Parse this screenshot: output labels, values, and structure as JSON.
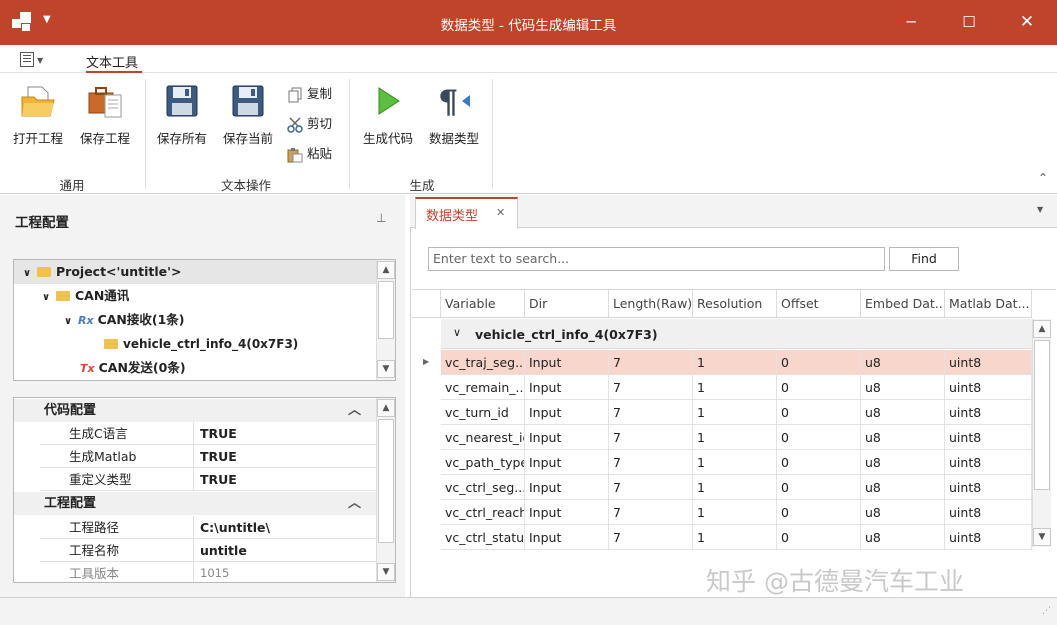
{
  "window": {
    "title": "数据类型 - 代码生成编辑工具"
  },
  "ribbon": {
    "tab_label": "文本工具",
    "buttons": {
      "open_project": "打开工程",
      "save_project": "保存工程",
      "save_all": "保存所有",
      "save_current": "保存当前",
      "copy": "复制",
      "cut": "剪切",
      "paste": "粘贴",
      "generate_code": "生成代码",
      "data_type": "数据类型"
    },
    "groups": {
      "general": "通用",
      "text_ops": "文本操作",
      "generate": "生成"
    }
  },
  "left_panel": {
    "title": "工程配置",
    "tree": {
      "project": "Project<'untitle'>",
      "can": "CAN通讯",
      "can_rx_icon": "Rx",
      "can_rx": "CAN接收(1条)",
      "message": "vehicle_ctrl_info_4(0x7F3)",
      "can_tx_icon": "Tx",
      "can_tx": "CAN发送(0条)"
    },
    "properties": {
      "cat1": "代码配置",
      "rows1": [
        {
          "key": "生成C语言",
          "value": "TRUE"
        },
        {
          "key": "生成Matlab",
          "value": "TRUE"
        },
        {
          "key": "重定义类型",
          "value": "TRUE"
        }
      ],
      "cat2": "工程配置",
      "rows2": [
        {
          "key": "工程路径",
          "value": "C:\\untitle\\"
        },
        {
          "key": "工程名称",
          "value": "untitle"
        },
        {
          "key": "工具版本",
          "value": "1015"
        }
      ]
    }
  },
  "doc": {
    "tab_label": "数据类型",
    "search_placeholder": "Enter text to search...",
    "find_label": "Find",
    "columns": [
      "Variable",
      "Dir",
      "Length(Raw)",
      "Resolution",
      "Offset",
      "Embed Dat...",
      "Matlab Dat..."
    ],
    "group_label": "vehicle_ctrl_info_4(0x7F3)",
    "rows": [
      [
        "vc_traj_seg...",
        "Input",
        "7",
        "1",
        "0",
        "u8",
        "uint8"
      ],
      [
        "vc_remain_...",
        "Input",
        "7",
        "1",
        "0",
        "u8",
        "uint8"
      ],
      [
        "vc_turn_id",
        "Input",
        "7",
        "1",
        "0",
        "u8",
        "uint8"
      ],
      [
        "vc_nearest_id",
        "Input",
        "7",
        "1",
        "0",
        "u8",
        "uint8"
      ],
      [
        "vc_path_type",
        "Input",
        "7",
        "1",
        "0",
        "u8",
        "uint8"
      ],
      [
        "vc_ctrl_seg...",
        "Input",
        "7",
        "1",
        "0",
        "u8",
        "uint8"
      ],
      [
        "vc_ctrl_reach",
        "Input",
        "7",
        "1",
        "0",
        "u8",
        "uint8"
      ],
      [
        "vc_ctrl_status",
        "Input",
        "7",
        "1",
        "0",
        "u8",
        "uint8"
      ]
    ],
    "selected_row_color": "#f9d6cc"
  },
  "watermark": "知乎 @古德曼汽车工业",
  "colors": {
    "accent": "#c0432b"
  }
}
